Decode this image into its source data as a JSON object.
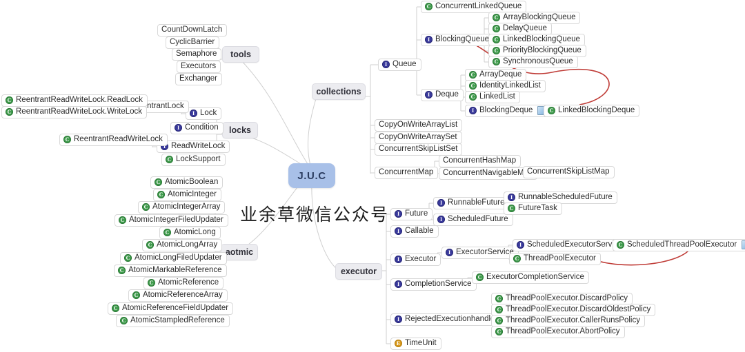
{
  "root": {
    "label": "J.U.C"
  },
  "watermark": {
    "text": "业余草微信公众号"
  },
  "colors": {
    "root_bg": "#a8c0e8",
    "category_bg": "#ececf0",
    "class_icon": "#3f9b4c",
    "interface_icon": "#3a3a9c",
    "enum_icon": "#d99a1d",
    "annotation_arrow": "#c0392b",
    "node_border": "#d8d8d8",
    "page_bg": "#ffffff"
  },
  "categories": {
    "tools": "tools",
    "collections": "collections",
    "locks": "locks",
    "aotmic": "aotmic",
    "executor": "executor"
  },
  "tools": {
    "items": [
      {
        "label": "CountDownLatch",
        "icon": "none"
      },
      {
        "label": "CyclicBarrier",
        "icon": "none"
      },
      {
        "label": "Semaphore",
        "icon": "none"
      },
      {
        "label": "Executors",
        "icon": "none"
      },
      {
        "label": "Exchanger",
        "icon": "none"
      }
    ]
  },
  "collections": {
    "queue": {
      "label": "Queue",
      "icon": "interface"
    },
    "queue_children": [
      {
        "label": "ConcurrentLinkedQueue",
        "icon": "class"
      },
      {
        "label": "BlockingQueue",
        "icon": "interface"
      }
    ],
    "blocking_queue_children": [
      {
        "label": "ArrayBlockingQueue",
        "icon": "class"
      },
      {
        "label": "DelayQueue",
        "icon": "class"
      },
      {
        "label": "LinkedBlockingQueue",
        "icon": "class"
      },
      {
        "label": "PriorityBlockingQueue",
        "icon": "class"
      },
      {
        "label": "SynchronousQueue",
        "icon": "class"
      }
    ],
    "deque": {
      "label": "Deque",
      "icon": "interface"
    },
    "deque_children": [
      {
        "label": "ArrayDeque",
        "icon": "class"
      },
      {
        "label": "IdentityLinkedList",
        "icon": "class"
      },
      {
        "label": "LinkedList",
        "icon": "class"
      },
      {
        "label": "BlockingDeque",
        "icon": "interface",
        "note": true
      }
    ],
    "blocking_deque_children": [
      {
        "label": "LinkedBlockingDeque",
        "icon": "class"
      }
    ],
    "direct": [
      {
        "label": "CopyOnWriteArrayList",
        "icon": "none"
      },
      {
        "label": "CopyOnWriteArraySet",
        "icon": "none"
      },
      {
        "label": "ConcurrentSkipListSet",
        "icon": "none"
      },
      {
        "label": "ConcurrentMap",
        "icon": "none"
      }
    ],
    "concurrent_map_children": [
      {
        "label": "ConcurrentHashMap",
        "icon": "none"
      },
      {
        "label": "ConcurrentNavigableMap",
        "icon": "none"
      }
    ],
    "concurrent_navigable_map_children": [
      {
        "label": "ConcurrentSkipListMap",
        "icon": "none"
      }
    ]
  },
  "locks": {
    "items": [
      {
        "label": "Lock",
        "icon": "interface"
      },
      {
        "label": "Condition",
        "icon": "interface"
      },
      {
        "label": "ReadWriteLock",
        "icon": "interface"
      },
      {
        "label": "LockSupport",
        "icon": "class"
      }
    ],
    "lock_children": [
      {
        "label": "ReentrantLock",
        "icon": "none"
      }
    ],
    "reentrant_lock_children": [
      {
        "label": "ReentrantReadWriteLock.ReadLock",
        "icon": "class"
      },
      {
        "label": "ReentrantReadWriteLock.WriteLock",
        "icon": "class"
      }
    ],
    "readwritelock_children": [
      {
        "label": "ReentrantReadWriteLock",
        "icon": "class"
      }
    ]
  },
  "aotmic": {
    "items": [
      {
        "label": "AtomicBoolean",
        "icon": "class"
      },
      {
        "label": "AtomicInteger",
        "icon": "class"
      },
      {
        "label": "AtomicIntegerArray",
        "icon": "class"
      },
      {
        "label": "AtomicIntegerFiledUpdater",
        "icon": "class"
      },
      {
        "label": "AtomicLong",
        "icon": "class"
      },
      {
        "label": "AtomicLongArray",
        "icon": "class"
      },
      {
        "label": "AtomicLongFiledUpdater",
        "icon": "class"
      },
      {
        "label": "AtomicMarkableReference",
        "icon": "class"
      },
      {
        "label": "AtomicReference",
        "icon": "class"
      },
      {
        "label": "AtomicReferenceArray",
        "icon": "class"
      },
      {
        "label": "AtomicReferenceFieldUpdater",
        "icon": "class"
      },
      {
        "label": "AtomicStampledReference",
        "icon": "class"
      }
    ]
  },
  "executor": {
    "items": [
      {
        "label": "Future",
        "icon": "interface"
      },
      {
        "label": "Callable",
        "icon": "interface"
      },
      {
        "label": "Executor",
        "icon": "interface"
      },
      {
        "label": "CompletionService",
        "icon": "interface"
      },
      {
        "label": "RejectedExecutionhandler",
        "icon": "interface"
      },
      {
        "label": "TimeUnit",
        "icon": "enum"
      }
    ],
    "future_children": [
      {
        "label": "RunnableFuture",
        "icon": "interface"
      },
      {
        "label": "ScheduledFuture",
        "icon": "interface"
      }
    ],
    "runnable_future_children": [
      {
        "label": "RunnableScheduledFuture",
        "icon": "interface"
      },
      {
        "label": "FutureTask",
        "icon": "class"
      }
    ],
    "executor_children": [
      {
        "label": "ExecutorService",
        "icon": "interface"
      }
    ],
    "executor_service_children": [
      {
        "label": "ScheduledExecutorService",
        "icon": "interface"
      },
      {
        "label": "ThreadPoolExecutor",
        "icon": "class"
      }
    ],
    "scheduled_executor_service_children": [
      {
        "label": "ScheduledThreadPoolExecutor",
        "icon": "class",
        "note": true
      }
    ],
    "completion_service_children": [
      {
        "label": "ExecutorCompletionService",
        "icon": "class"
      }
    ],
    "rejected_handler_children": [
      {
        "label": "ThreadPoolExecutor.DiscardPolicy",
        "icon": "class"
      },
      {
        "label": "ThreadPoolExecutor.DiscardOldestPolicy",
        "icon": "class"
      },
      {
        "label": "ThreadPoolExecutor.CallerRunsPolicy",
        "icon": "class"
      },
      {
        "label": "ThreadPoolExecutor.AbortPolicy",
        "icon": "class"
      }
    ]
  },
  "annotations": [
    {
      "name": "arrow-linkedblockingdeque-to-blockingqueue"
    },
    {
      "name": "arrow-scheduledthreadpoolexecutor-to-threadpoolexecutor"
    }
  ]
}
